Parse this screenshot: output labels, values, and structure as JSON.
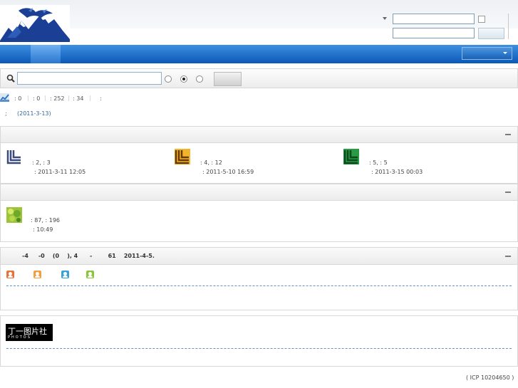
{
  "stats": {
    "item1": ": 0",
    "item2": ": 0",
    "item3": ": 252",
    "item4": ": 34",
    "item5": ":",
    "separator": "|"
  },
  "announcement": {
    "prefix": ";",
    "link": "(2011-3-13)"
  },
  "forums": [
    {
      "line1": ": 2,  : 3",
      "line2": ": 2011-3-11 12:05",
      "icon": "forum-icon-navy",
      "color": "#3c4a7a"
    },
    {
      "line1": ": 4,  : 12",
      "line2": ": 2011-5-10 16:59",
      "icon": "forum-icon-orange",
      "color": "#e8a020"
    },
    {
      "line1": ": 5,  : 5",
      "line2": ": 2011-3-15 00:03",
      "icon": "forum-icon-green",
      "color": "#2a8a3a"
    },
    {
      "line1": ": 87,  : 196",
      "line2": ":    10:49",
      "icon": "forum-icon-photo"
    }
  ],
  "online": {
    "summary": "-4     -0    (0    ), 4      -        61    2011-4-5."
  },
  "links": {
    "logo_cn": "丁一图片社",
    "logo_en": "PHOTOS"
  },
  "footer": {
    "icp": "(  ICP 10204650  )"
  },
  "icons": {
    "search": "search-icon",
    "stats": "stats-chart-icon",
    "collapse": "collapse-minus-icon",
    "user": "user-icon"
  }
}
